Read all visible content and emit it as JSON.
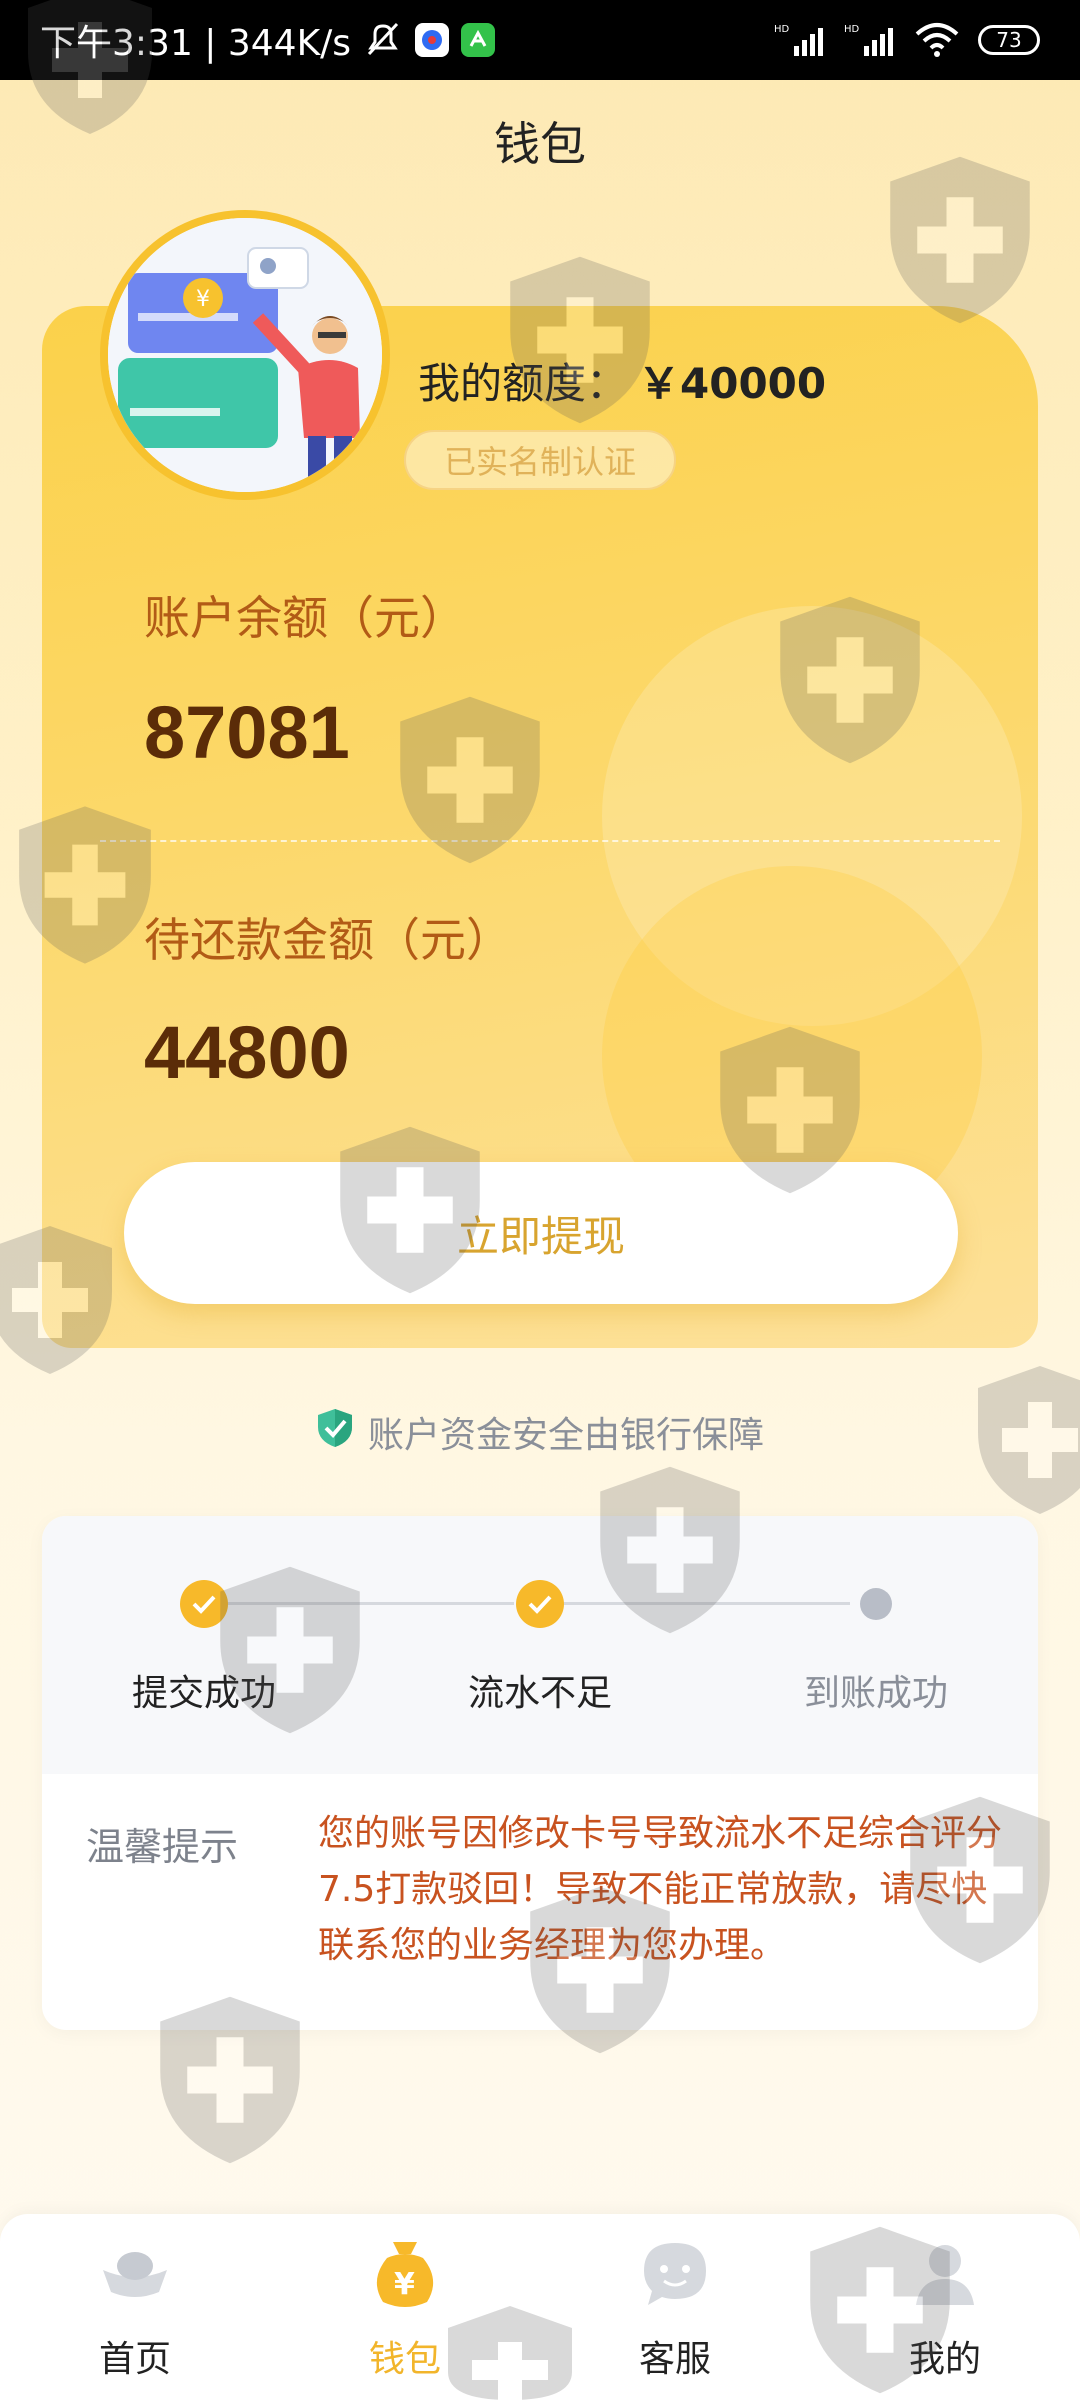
{
  "status_bar": {
    "time_speed": "下午3:31 | 344K/s",
    "battery": "73",
    "signal_labels": [
      "HD",
      "HD"
    ]
  },
  "header": {
    "title": "钱包"
  },
  "card": {
    "limit_label": "我的额度：",
    "limit_amount": "￥40000",
    "verified_badge": "已实名制认证",
    "balance_label": "账户余额（元）",
    "balance_value": "87081",
    "repay_label": "待还款金额（元）",
    "repay_value": "44800",
    "withdraw_button": "立即提现"
  },
  "safety_note": "账户资金安全由银行保障",
  "progress": {
    "steps": [
      {
        "label": "提交成功",
        "state": "done"
      },
      {
        "label": "流水不足",
        "state": "done"
      },
      {
        "label": "到账成功",
        "state": "pending"
      }
    ],
    "tip_label": "温馨提示",
    "tip_text": "您的账号因修改卡号导致流水不足综合评分7.5打款驳回！导致不能正常放款，请尽快联系您的业务经理为您办理。"
  },
  "bottom_nav": {
    "items": [
      {
        "label": "首页",
        "icon": "ingot-icon",
        "active": false
      },
      {
        "label": "钱包",
        "icon": "money-bag-icon",
        "active": true
      },
      {
        "label": "客服",
        "icon": "chat-bubble-icon",
        "active": false
      },
      {
        "label": "我的",
        "icon": "person-icon",
        "active": false
      }
    ]
  },
  "colors": {
    "accent": "#f2b52b",
    "card_top": "#fbd14a",
    "tip_text": "#c8521f",
    "value_brown": "#5b2c08",
    "label_brown": "#b25b16"
  }
}
